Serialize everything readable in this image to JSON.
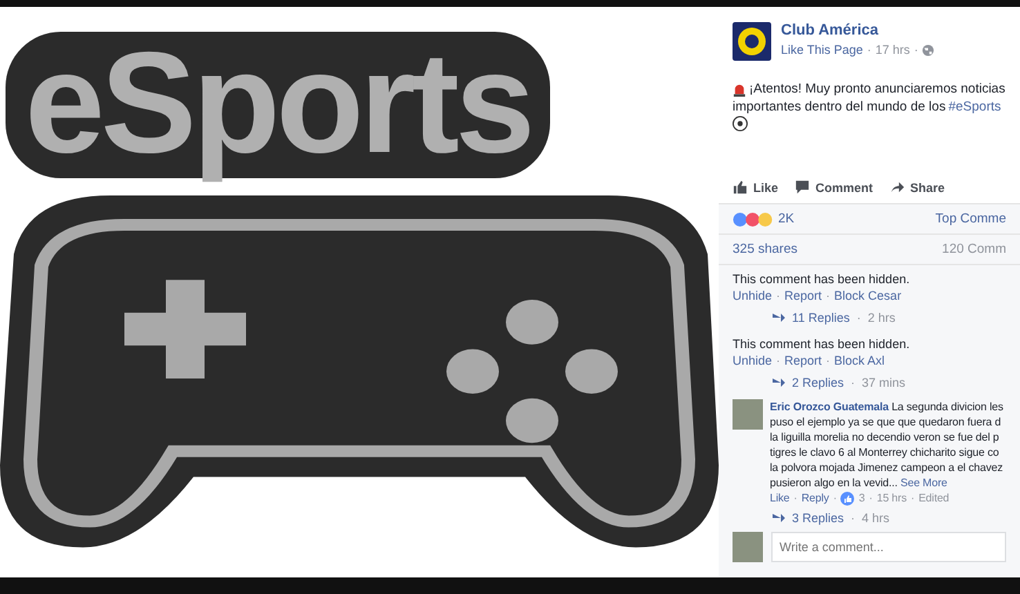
{
  "image": {
    "logo_text": "eSports"
  },
  "separator": "·",
  "post": {
    "page_name": "Club América",
    "like_page": "Like This Page",
    "time": "17 hrs",
    "text": "¡Atentos! Muy pronto anunciaremos noticias",
    "text_2": "importantes dentro del mundo de los",
    "hashtag": "#eSports",
    "actions": [
      "Like",
      "Comment",
      "Share"
    ],
    "reactions_count": "2K",
    "top_comments": "Top Comme",
    "shares": "325 shares",
    "comments_count": "120 Comm"
  },
  "comments": [
    {
      "kind": "hidden",
      "text": "This comment has been hidden.",
      "links": [
        "Unhide",
        "Report",
        "Block Cesar"
      ],
      "replies": "11 Replies",
      "replies_time": "2 hrs"
    },
    {
      "kind": "hidden",
      "text": "This comment has been hidden.",
      "links": [
        "Unhide",
        "Report",
        "Block Axl"
      ],
      "replies": "2 Replies",
      "replies_time": "37 mins"
    },
    {
      "kind": "full",
      "author": "Eric Orozco Guatemala",
      "lines": [
        "La segunda divicion les",
        "puso el ejemplo ya se que que quedaron fuera d",
        "la liguilla morelia no decendio veron se fue del p",
        "tigres le clavo 6 al Monterrey chicharito sigue co",
        "la polvora mojada Jimenez campeon a el chavez",
        "pusieron algo en la vevid..."
      ],
      "see_more": "See More",
      "links": [
        "Like",
        "Reply"
      ],
      "likes": "3",
      "time": "15 hrs",
      "edited": "Edited",
      "replies": "3 Replies",
      "replies_time": "4 hrs"
    }
  ],
  "composer": {
    "placeholder": "Write a comment..."
  }
}
